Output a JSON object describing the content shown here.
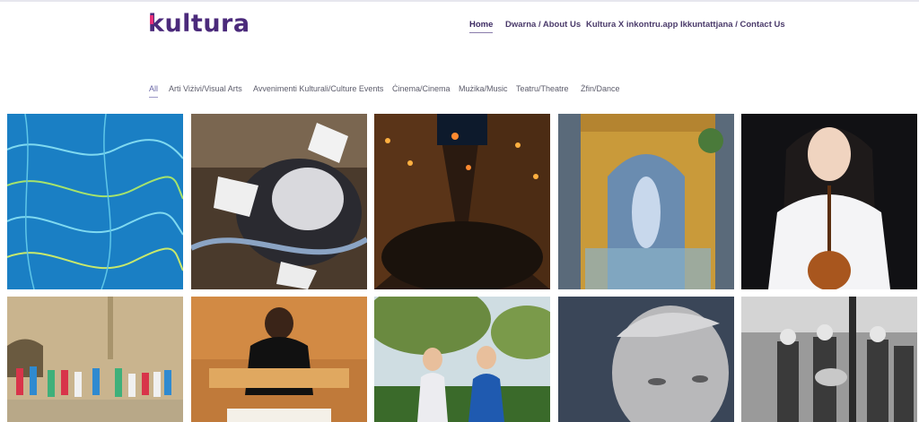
{
  "brand": {
    "logo_text": "kultura",
    "logo_color": "#4b2a7b",
    "accent": "#e8317a"
  },
  "nav": {
    "items": [
      {
        "label": "Home",
        "active": true
      },
      {
        "label": "Dwarna / About Us"
      },
      {
        "label": "Kultura X inkontru.app"
      },
      {
        "label": "Ikkuntattjana / Contact Us"
      }
    ]
  },
  "filters": {
    "items": [
      {
        "label": "All",
        "active": true
      },
      {
        "label": "Arti Viżivi/Visual Arts"
      },
      {
        "label": "Avvenimenti Kulturali/Culture Events"
      },
      {
        "label": "Ċinema/Cinema"
      },
      {
        "label": "Mużika/Music"
      },
      {
        "label": "Teatru/Theatre"
      },
      {
        "label": "Żfin/Dance"
      }
    ]
  },
  "gallery": {
    "tiles": [
      {
        "subject": "abstract blue line art"
      },
      {
        "subject": "sculpture of flying paper sheets"
      },
      {
        "subject": "lit street at night with crowd"
      },
      {
        "subject": "painted baroque church facade"
      },
      {
        "subject": "violinist portrait"
      },
      {
        "subject": "youth orchestra group photo"
      },
      {
        "subject": "organist at keyboard"
      },
      {
        "subject": "two women outdoors"
      },
      {
        "subject": "marble statue head"
      },
      {
        "subject": "historic brass band photo"
      }
    ]
  }
}
